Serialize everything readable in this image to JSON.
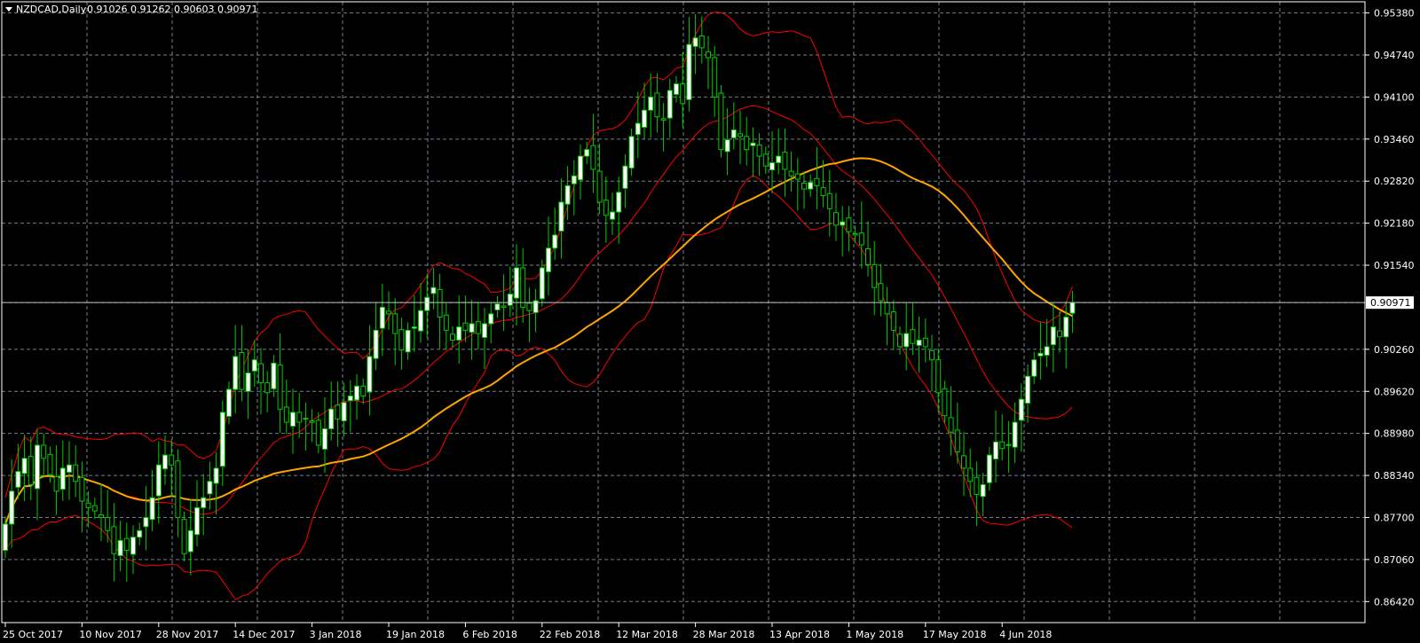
{
  "header": {
    "symbol": "NZDCAD,Daily",
    "ohlc": "0.91026 0.91262 0.90603 0.90971"
  },
  "current_price_label": "0.90971",
  "colors": {
    "background": "#000000",
    "grid": "#6f7f8f",
    "frame": "#ffffff",
    "bull_body": "#ffffff",
    "bull_wick": "#00cc00",
    "bear_body": "#000000",
    "bear_wick": "#00cc00",
    "bollinger": "#ff0000",
    "moving_average": "#ffa500"
  },
  "chart_data": {
    "type": "candlestick",
    "symbol": "NZDCAD",
    "timeframe": "Daily",
    "grid": true,
    "ylim": [
      0.861,
      0.9555
    ],
    "y_ticks": [
      "0.95380",
      "0.94740",
      "0.94100",
      "0.93460",
      "0.92820",
      "0.92180",
      "0.91540",
      "0.90971",
      "0.90260",
      "0.89620",
      "0.88980",
      "0.88340",
      "0.87700",
      "0.87060",
      "0.86420"
    ],
    "x_tick_labels": [
      {
        "index": 0,
        "label": "25 Oct 2017"
      },
      {
        "index": 12,
        "label": "10 Nov 2017"
      },
      {
        "index": 24,
        "label": "28 Nov 2017"
      },
      {
        "index": 36,
        "label": "14 Dec 2017"
      },
      {
        "index": 48,
        "label": "3 Jan 2018"
      },
      {
        "index": 60,
        "label": "19 Jan 2018"
      },
      {
        "index": 72,
        "label": "6 Feb 2018"
      },
      {
        "index": 84,
        "label": "22 Feb 2018"
      },
      {
        "index": 96,
        "label": "12 Mar 2018"
      },
      {
        "index": 108,
        "label": "28 Mar 2018"
      },
      {
        "index": 120,
        "label": "13 Apr 2018"
      },
      {
        "index": 132,
        "label": "1 May 2018"
      },
      {
        "index": 144,
        "label": "17 May 2018"
      },
      {
        "index": 156,
        "label": "4 Jun 2018"
      }
    ],
    "closes": [
      0.876,
      0.881,
      0.884,
      0.886,
      0.882,
      0.888,
      0.886,
      0.8835,
      0.881,
      0.8845,
      0.885,
      0.8825,
      0.8795,
      0.8785,
      0.878,
      0.877,
      0.875,
      0.8715,
      0.8735,
      0.872,
      0.874,
      0.875,
      0.877,
      0.88,
      0.885,
      0.8865,
      0.885,
      0.877,
      0.8715,
      0.875,
      0.8785,
      0.88,
      0.8825,
      0.8845,
      0.893,
      0.8965,
      0.9015,
      0.8965,
      0.899,
      0.901,
      0.8975,
      0.896,
      0.9005,
      0.8935,
      0.8915,
      0.893,
      0.8915,
      0.892,
      0.8915,
      0.888,
      0.8905,
      0.8935,
      0.892,
      0.8945,
      0.8955,
      0.897,
      0.8955,
      0.9015,
      0.9055,
      0.909,
      0.908,
      0.905,
      0.9025,
      0.9055,
      0.906,
      0.9085,
      0.9105,
      0.912,
      0.9075,
      0.9055,
      0.904,
      0.906,
      0.9055,
      0.9065,
      0.905,
      0.9065,
      0.908,
      0.9095,
      0.909,
      0.911,
      0.915,
      0.909,
      0.9085,
      0.91,
      0.915,
      0.918,
      0.92,
      0.925,
      0.9275,
      0.929,
      0.932,
      0.933,
      0.93,
      0.925,
      0.923,
      0.9235,
      0.9265,
      0.9305,
      0.935,
      0.937,
      0.939,
      0.941,
      0.938,
      0.9375,
      0.942,
      0.943,
      0.94,
      0.949,
      0.95,
      0.9485,
      0.947,
      0.941,
      0.933,
      0.9345,
      0.936,
      0.935,
      0.933,
      0.934,
      0.932,
      0.9305,
      0.931,
      0.932,
      0.93,
      0.929,
      0.9285,
      0.927,
      0.928,
      0.9275,
      0.926,
      0.924,
      0.9215,
      0.922,
      0.9205,
      0.92,
      0.9185,
      0.9155,
      0.912,
      0.91,
      0.908,
      0.9055,
      0.903,
      0.905,
      0.9035,
      0.904,
      0.903,
      0.901,
      0.896,
      0.8925,
      0.89,
      0.887,
      0.8845,
      0.8825,
      0.8805,
      0.882,
      0.8865,
      0.8885,
      0.8875,
      0.888,
      0.8915,
      0.895,
      0.8985,
      0.901,
      0.902,
      0.903,
      0.906,
      0.9045,
      0.9075,
      0.9097
    ]
  }
}
